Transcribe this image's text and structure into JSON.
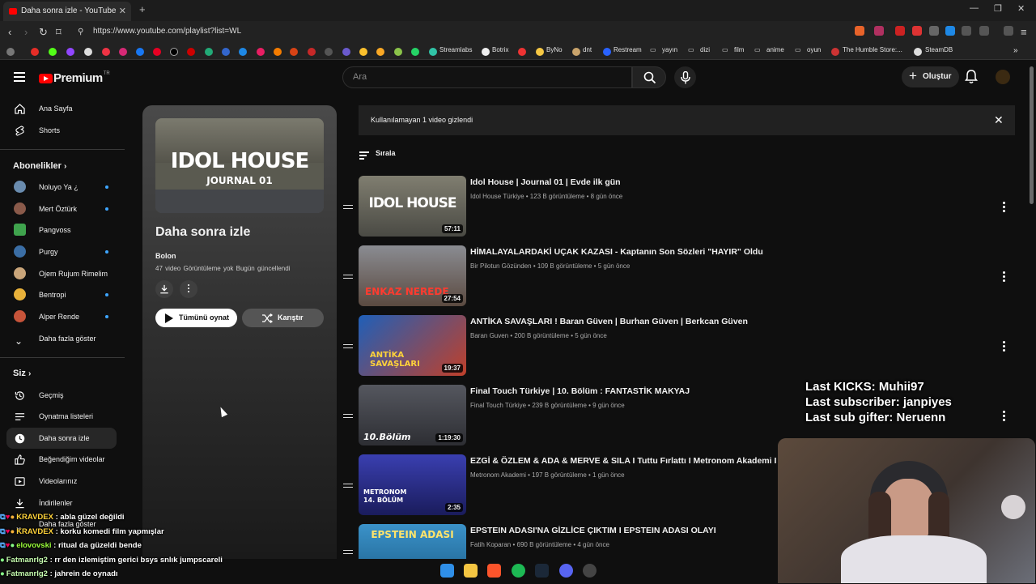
{
  "browser": {
    "tab_title": "Daha sonra izle - YouTube",
    "url": "https://www.youtube.com/playlist?list=WL",
    "bookmarks": [
      "Streamlabs",
      "Botrix",
      "ByNo",
      "dnt",
      "Restream",
      "yayın",
      "dizi",
      "film",
      "anime",
      "oyun",
      "The Humble Store:...",
      "SteamDB"
    ]
  },
  "header": {
    "logo_text": "Premium",
    "logo_sup": "TR",
    "search_placeholder": "Ara",
    "create_label": "Oluştur"
  },
  "sidebar": {
    "home": "Ana Sayfa",
    "shorts": "Shorts",
    "subs_heading": "Abonelikler",
    "subs": [
      {
        "name": "Noluyo Ya ¿",
        "color": "#6a8caf"
      },
      {
        "name": "Mert Öztürk",
        "color": "#8a5a4a"
      },
      {
        "name": "Pangvoss",
        "color": "#3fa34d"
      },
      {
        "name": "Purgy",
        "color": "#3b6ea5"
      },
      {
        "name": "Ojem Rujum Rimelim",
        "color": "#c9a57a"
      },
      {
        "name": "Bentropi",
        "color": "#e8b13a"
      },
      {
        "name": "Alper Rende",
        "color": "#c7543a"
      }
    ],
    "show_more": "Daha fazla göster",
    "you_heading": "Siz",
    "you_items": [
      "Geçmiş",
      "Oynatma listeleri",
      "Daha sonra izle",
      "Beğendiğim videolar",
      "Videolarınız",
      "İndirilenler",
      "Daha fazla göster"
    ]
  },
  "playlist": {
    "thumb_line1": "IDOL HOUSE",
    "thumb_line2": "JOURNAL 01",
    "title": "Daha sonra izle",
    "owner": "Bolon",
    "meta": "47 video  Görüntüleme yok  Bugün güncellendi",
    "play_all": "Tümünü oynat",
    "shuffle": "Karıştır"
  },
  "notice": "Kullanılamayan 1 video gizlendi",
  "sort_label": "Sırala",
  "videos": [
    {
      "title": "Idol House | Journal 01 | Evde ilk gün",
      "meta": "Idol House Türkiye • 123 B görüntüleme • 8 gün önce",
      "duration": "57:11",
      "thumb": "IDOL HOUSE",
      "bg": "#5b5a4e"
    },
    {
      "title": "HİMALAYALARDAKİ UÇAK KAZASI - Kaptanın Son Sözleri \"HAYIR\" Oldu",
      "meta": "Bir Pilotun Gözünden • 109 B görüntüleme • 5 gün önce",
      "duration": "27:54",
      "thumb": "ENKAZ NEREDE",
      "bg": "#6d6e72"
    },
    {
      "title": "ANTİKA SAVAŞLARI ! Baran Güven | Burhan Güven | Berkcan Güven",
      "meta": "Baran Guven • 200 B görüntüleme • 5 gün önce",
      "duration": "19:37",
      "thumb": "ANTİKA SAVAŞLARI",
      "bg": "#2a5fa8"
    },
    {
      "title": "Final Touch Türkiye | 10. Bölüm : FANTASTİK MAKYAJ",
      "meta": "Final Touch Türkiye • 239 B görüntüleme • 9 gün önce",
      "duration": "1:19:30",
      "thumb": "10.Bölüm",
      "bg": "#3b3d44"
    },
    {
      "title": "EZGİ & ÖZLEM & ADA & MERVE & SILA I Tuttu Fırlattı I Metronom Akademi I Perf",
      "meta": "Metronom Akademi • 197 B görüntüleme • 1 gün önce",
      "duration": "2:35",
      "thumb": "METRONOM 14. BÖLÜM",
      "bg": "#2c2f8a"
    },
    {
      "title": "EPSTEIN ADASI'NA GİZLİCE ÇIKTIM I EPSTEIN ADASI OLAYI",
      "meta": "Fatih Koparan • 690 B görüntüleme • 4 gün önce",
      "duration": "",
      "thumb": "EPSTEIN ADASI",
      "bg": "#2f7fb5"
    }
  ],
  "overlay": {
    "last_kicks": "Last KICKS: Muhii97",
    "last_sub": "Last subscriber: janpiyes",
    "last_gifter": "Last sub gifter: Neruenn"
  },
  "chat": [
    {
      "user": "KRAVDEX",
      "text": ": abla güzel değildi",
      "color": "#ffd33a"
    },
    {
      "user": "KRAVDEX",
      "text": ": korku komedi film yapmışlar",
      "color": "#ffd33a"
    },
    {
      "user": "elovovski",
      "text": ": ritual da güzeldi bende",
      "color": "#9bff3a"
    },
    {
      "user": "Fatmanrlg2",
      "text": ": rr den izlemiştim gerici bsys snlık jumpscareli",
      "color": "#c7ffb0"
    },
    {
      "user": "Fatmanrlg2",
      "text": ": jahrein de oynadı",
      "color": "#c7ffb0"
    }
  ]
}
